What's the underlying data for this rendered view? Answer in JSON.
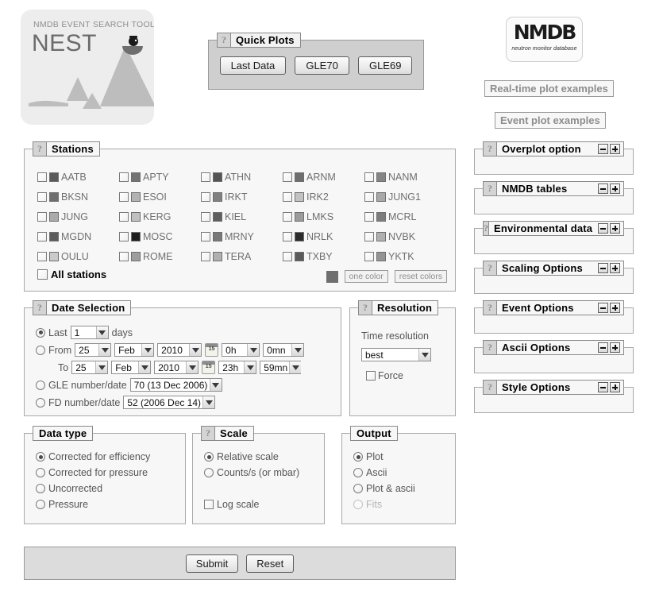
{
  "brand": {
    "nest_subtitle": "NMDB EVENT SEARCH TOOL",
    "nest_title": "NEST",
    "nmdb_wordmark": "NMDB",
    "nmdb_tagline": "neutron monitor database"
  },
  "quick_plots": {
    "legend": "Quick Plots",
    "help": "?",
    "buttons": [
      "Last Data",
      "GLE70",
      "GLE69"
    ]
  },
  "example_links": {
    "realtime": "Real-time plot examples",
    "event": "Event plot examples"
  },
  "stations": {
    "legend": "Stations",
    "help": "?",
    "all_label": "All stations",
    "all_checked": false,
    "one_color_label": "one color",
    "reset_colors_label": "reset colors",
    "one_color_swatch": "#6f6f6f",
    "items": [
      {
        "code": "AATB",
        "color": "#5a5a5a",
        "checked": false
      },
      {
        "code": "APTY",
        "color": "#737373",
        "checked": false
      },
      {
        "code": "ATHN",
        "color": "#545454",
        "checked": false
      },
      {
        "code": "ARNM",
        "color": "#6e6e6e",
        "checked": false
      },
      {
        "code": "NANM",
        "color": "#858585",
        "checked": false
      },
      {
        "code": "BKSN",
        "color": "#6e6e6e",
        "checked": false
      },
      {
        "code": "ESOI",
        "color": "#b3b3b3",
        "checked": false
      },
      {
        "code": "IRKT",
        "color": "#808080",
        "checked": false
      },
      {
        "code": "IRK2",
        "color": "#c2c2c2",
        "checked": false
      },
      {
        "code": "JUNG1",
        "color": "#a8a8a8",
        "checked": false
      },
      {
        "code": "JUNG",
        "color": "#aaaaaa",
        "checked": false
      },
      {
        "code": "KERG",
        "color": "#c0c0c0",
        "checked": false
      },
      {
        "code": "KIEL",
        "color": "#5e5e5e",
        "checked": false
      },
      {
        "code": "LMKS",
        "color": "#9b9b9b",
        "checked": false
      },
      {
        "code": "MCRL",
        "color": "#7d7d7d",
        "checked": false
      },
      {
        "code": "MGDN",
        "color": "#5c5c5c",
        "checked": false
      },
      {
        "code": "MOSC",
        "color": "#1c1c1c",
        "checked": false
      },
      {
        "code": "MRNY",
        "color": "#787878",
        "checked": false
      },
      {
        "code": "NRLK",
        "color": "#2b2b2b",
        "checked": false
      },
      {
        "code": "NVBK",
        "color": "#b0b0b0",
        "checked": false
      },
      {
        "code": "OULU",
        "color": "#cacaca",
        "checked": false
      },
      {
        "code": "ROME",
        "color": "#9d9d9d",
        "checked": false
      },
      {
        "code": "TERA",
        "color": "#b0b0b0",
        "checked": false
      },
      {
        "code": "TXBY",
        "color": "#5a5a5a",
        "checked": false
      },
      {
        "code": "YKTK",
        "color": "#949494",
        "checked": false
      }
    ]
  },
  "date_selection": {
    "legend": "Date Selection",
    "help": "?",
    "last": {
      "label": "Last",
      "unit": "days",
      "value": "1",
      "selected": true
    },
    "from": {
      "label": "From",
      "day": "25",
      "month": "Feb",
      "year": "2010",
      "hour": "0h",
      "minute": "0mn",
      "selected": false
    },
    "to": {
      "label": "To",
      "day": "25",
      "month": "Feb",
      "year": "2010",
      "hour": "23h",
      "minute": "59mn"
    },
    "gle": {
      "label": "GLE number/date",
      "value": "70 (13 Dec 2006)",
      "selected": false
    },
    "fd": {
      "label": "FD number/date",
      "value": "52 (2006 Dec 14)",
      "selected": false
    },
    "calendar_day": "15"
  },
  "resolution": {
    "legend": "Resolution",
    "help": "?",
    "time_label": "Time resolution",
    "value": "best",
    "force_label": "Force",
    "force_checked": false
  },
  "right_panels": [
    {
      "title": "Overplot option",
      "help": "?",
      "minus": "−",
      "plus": "+"
    },
    {
      "title": "NMDB tables",
      "help": "?",
      "minus": "−",
      "plus": "+"
    },
    {
      "title": "Environmental data",
      "help": "?",
      "minus": "−",
      "plus": "+"
    },
    {
      "title": "Scaling Options",
      "help": "?",
      "minus": "−",
      "plus": "+"
    },
    {
      "title": "Event Options",
      "help": "?",
      "minus": "−",
      "plus": "+"
    },
    {
      "title": "Ascii Options",
      "help": "?",
      "minus": "−",
      "plus": "+"
    },
    {
      "title": "Style Options",
      "help": "?",
      "minus": "−",
      "plus": "+"
    }
  ],
  "data_type": {
    "legend": "Data type",
    "options": [
      {
        "label": "Corrected for efficiency",
        "selected": true
      },
      {
        "label": "Corrected for pressure",
        "selected": false
      },
      {
        "label": "Uncorrected",
        "selected": false
      },
      {
        "label": "Pressure",
        "selected": false
      }
    ]
  },
  "scale": {
    "legend": "Scale",
    "help": "?",
    "options": [
      {
        "label": "Relative scale",
        "selected": true
      },
      {
        "label": "Counts/s (or mbar)",
        "selected": false
      }
    ],
    "log_label": "Log scale",
    "log_checked": false
  },
  "output": {
    "legend": "Output",
    "options": [
      {
        "label": "Plot",
        "selected": true,
        "disabled": false
      },
      {
        "label": "Ascii",
        "selected": false,
        "disabled": false
      },
      {
        "label": "Plot & ascii",
        "selected": false,
        "disabled": false
      },
      {
        "label": "Fits",
        "selected": false,
        "disabled": true
      }
    ]
  },
  "actions": {
    "submit": "Submit",
    "reset": "Reset"
  }
}
